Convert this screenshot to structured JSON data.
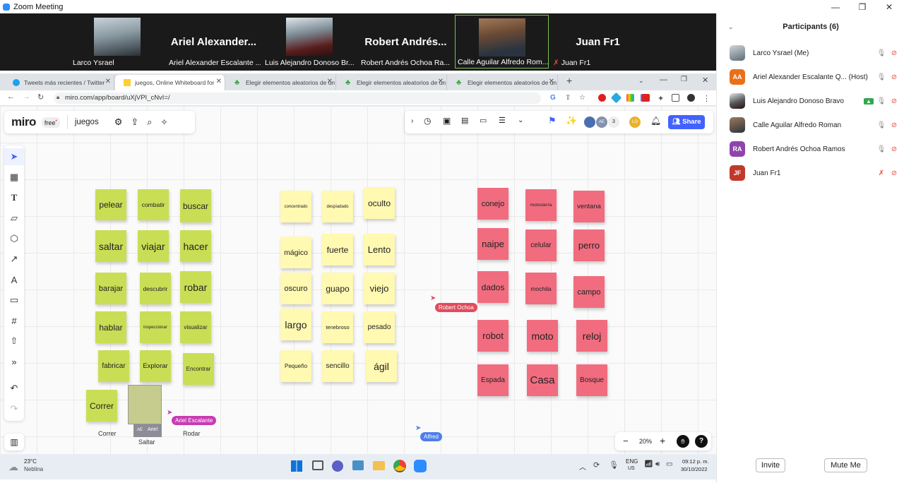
{
  "window": {
    "title": "Zoom Meeting",
    "min": "—",
    "max": "❐",
    "close": "✕"
  },
  "video_strip": [
    {
      "kind": "photo",
      "label": "Larco Ysrael"
    },
    {
      "kind": "name",
      "big": "Ariel  Alexander...",
      "label": "Ariel Alexander Escalante ..."
    },
    {
      "kind": "photo",
      "label": "Luis Alejandro Donoso Br..."
    },
    {
      "kind": "name",
      "big": "Robert  Andrés...",
      "label": "Robert Andrés Ochoa Ra..."
    },
    {
      "kind": "photo",
      "label": "Calle Aguilar Alfredo Rom...",
      "active": true
    },
    {
      "kind": "name",
      "big": "Juan Fr1",
      "label": "Juan Fr1",
      "muted": true
    }
  ],
  "browser": {
    "tabs": [
      {
        "label": "Tweets más recientes / Twitter",
        "close": "✕"
      },
      {
        "label": "juegos, Online Whiteboard for Vi",
        "close": "✕",
        "active": true
      },
      {
        "label": "Elegir elementos aleatorios de un",
        "close": "✕"
      },
      {
        "label": "Elegir elementos aleatorios de un",
        "close": "✕"
      },
      {
        "label": "Elegir elementos aleatorios de un",
        "close": "✕"
      }
    ],
    "new_tab": "+",
    "url": "miro.com/app/board/uXjVPI_cNvI=/"
  },
  "miro": {
    "logo": "miro",
    "plan": "free",
    "board_name": "juegos",
    "share": "Share",
    "collab_count": "3",
    "avatar_ae": "AE",
    "avatar_lo": "LO",
    "zoom": "20%",
    "zoom_minus": "−",
    "zoom_plus": "+",
    "help": "?"
  },
  "notes": {
    "green": [
      "pelear",
      "combatir",
      "buscar",
      "saltar",
      "viajar",
      "hacer",
      "barajar",
      "descubrir",
      "robar",
      "hablar",
      "inspeccionar",
      "visualizar",
      "fabricar",
      "Explorar",
      "Encontrar",
      "Correr"
    ],
    "yellow": [
      "concentrado",
      "despiadado",
      "oculto",
      "mágico",
      "fuerte",
      "Lento",
      "oscuro",
      "guapo",
      "viejo",
      "largo",
      "tenebroso",
      "pesado",
      "Pequeño",
      "sencillo",
      "ágil"
    ],
    "pink": [
      "conejo",
      "motosierra",
      "ventana",
      "naipe",
      "celular",
      "perro",
      "dados",
      "mochila",
      "campo",
      "robot",
      "moto",
      "reloj",
      "Espada",
      "Casa",
      "Bosque"
    ]
  },
  "board_labels": {
    "correr": "Correr",
    "saltar": "Saltar",
    "rodar": "Rodar"
  },
  "cursors": {
    "ariel": "Ariel Escalante",
    "robert": "Robert Ochoa",
    "alfred": "Alfred",
    "ae_tag": "AE",
    "ariel_small": "Ariel"
  },
  "participants": {
    "title": "Participants (6)",
    "list": [
      {
        "initials": "",
        "name": "Larco Ysrael (Me)",
        "color": "#777"
      },
      {
        "initials": "AA",
        "name": "Ariel Alexander Escalante Q...  (Host)",
        "color": "#e8701a"
      },
      {
        "initials": "",
        "name": "Luis Alejandro Donoso Bravo",
        "color": "#555"
      },
      {
        "initials": "",
        "name": "Calle Aguilar Alfredo Roman",
        "color": "#666"
      },
      {
        "initials": "RA",
        "name": "Robert Andrés Ochoa Ramos",
        "color": "#8e44ad"
      },
      {
        "initials": "JF",
        "name": "Juan Fr1",
        "color": "#c0392b"
      }
    ],
    "invite": "Invite",
    "mute_me": "Mute Me"
  },
  "taskbar": {
    "temp": "23°C",
    "weather": "Neblina",
    "lang": "ENG",
    "region": "US",
    "time": "09:12 p. m.",
    "date": "30/10/2022"
  }
}
